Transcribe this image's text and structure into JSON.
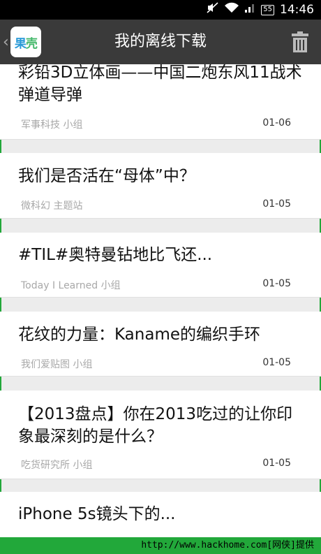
{
  "status_bar": {
    "battery": "55",
    "time": "14:46"
  },
  "header": {
    "back_chevron": "‹",
    "logo_text_1": "果",
    "logo_text_2": "壳",
    "title": "我的离线下载",
    "trash_icon": "trash-icon"
  },
  "items": [
    {
      "title": "彩铅3D立体画——中国二炮东风11战术弹道导弹",
      "source": "军事科技 小组",
      "date": "01-06"
    },
    {
      "title": "我们是否活在“母体”中？",
      "source": "微科幻 主题站",
      "date": "01-05"
    },
    {
      "title": "#TIL#奥特曼钻地比飞还...",
      "source": "Today I Learned 小组",
      "date": "01-05"
    },
    {
      "title": "花纹的力量：Kaname的编织手环",
      "source": "我们爱贴图 小组",
      "date": "01-05"
    },
    {
      "title": "【2013盘点】你在2013吃过的让你印象最深刻的是什么？",
      "source": "吃货研究所 小组",
      "date": "01-05"
    },
    {
      "title": "iPhone 5s镜头下的...",
      "source": "",
      "date": ""
    }
  ],
  "footer": {
    "text": "http://www.hackhome.com[网侠]提供"
  },
  "colors": {
    "header_bg": "#3a3a3a",
    "list_bg": "#ececec",
    "card_bg": "#ffffff",
    "footer_bg": "#22a83a"
  }
}
